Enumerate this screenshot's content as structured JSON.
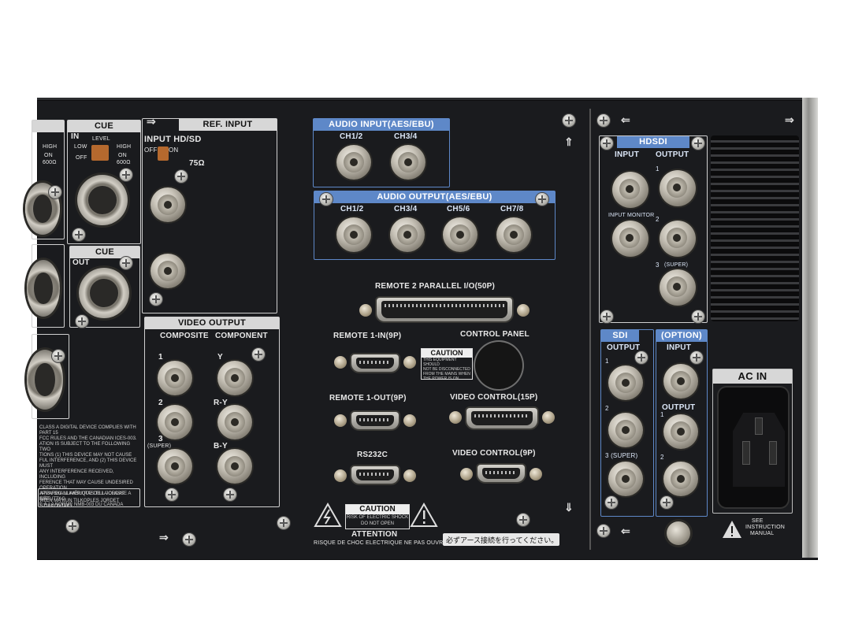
{
  "sections": {
    "cue_in": {
      "title": "CUE",
      "in": "IN",
      "level": "LEVEL",
      "low": "LOW",
      "high": "HIGH",
      "off": "OFF",
      "on": "ON",
      "ohm": "600Ω"
    },
    "cue_out": {
      "title": "CUE",
      "out": "OUT"
    },
    "left_partial": {
      "high": "HIGH",
      "on": "ON",
      "ohm": "600Ω"
    },
    "ref_input": {
      "title": "REF. INPUT",
      "input": "INPUT HD/SD",
      "off": "OFF",
      "on": "ON",
      "ohm": "75Ω"
    },
    "video_output": {
      "title": "VIDEO OUTPUT",
      "composite": "COMPOSITE",
      "component": "COMPONENT",
      "r1": "1",
      "r2": "2",
      "r3": "3",
      "super": "(SUPER)",
      "y": "Y",
      "ry": "R-Y",
      "by": "B-Y"
    },
    "audio_input": {
      "title": "AUDIO INPUT(AES/EBU)",
      "ch12": "CH1/2",
      "ch34": "CH3/4"
    },
    "audio_output": {
      "title": "AUDIO OUTPUT(AES/EBU)",
      "ch12": "CH1/2",
      "ch34": "CH3/4",
      "ch56": "CH5/6",
      "ch78": "CH7/8"
    },
    "hdsdi": {
      "title": "HDSDI",
      "input": "INPUT",
      "output": "OUTPUT",
      "input_monitor": "INPUT MONITOR",
      "n1": "1",
      "n2": "2",
      "n3": "3",
      "super": "(SUPER)"
    },
    "sdi": {
      "title": "SDI",
      "output": "OUTPUT",
      "n1": "1",
      "n2": "2",
      "n3": "3 (SUPER)"
    },
    "option": {
      "title": "(OPTION)",
      "input": "INPUT",
      "output": "OUTPUT",
      "n1": "1",
      "n2": "2"
    },
    "ac_in": {
      "title": "AC IN",
      "see": "SEE",
      "instruction": "INSTRUCTION",
      "manual": "MANUAL"
    }
  },
  "connectors": {
    "remote2": "REMOTE 2 PARALLEL I/O(50P)",
    "remote1_in": "REMOTE 1-IN(9P)",
    "control_panel": "CONTROL PANEL",
    "remote1_out": "REMOTE 1-OUT(9P)",
    "video_control_15p": "VIDEO CONTROL(15P)",
    "rs232c": "RS232C",
    "video_control_9p": "VIDEO CONTROL(9P)"
  },
  "caution_small": {
    "title": "CAUTION",
    "line1": "THIS EQUIPMENT SHOULD",
    "line2": "NOT BE DISCONNECTED",
    "line3": "FROM THE MAINS WHEN",
    "line4": "THE POWER IS ON"
  },
  "caution_main": {
    "title": "CAUTION",
    "line1": "RISK OF ELECTRIC SHOCK",
    "line2": "DO NOT OPEN",
    "attention": "ATTENTION",
    "french": "RISQUE DE CHOC ELECTRIQUE    NE PAS OUVRIR",
    "japanese": "必ずアース接続を行ってください。"
  },
  "fcc_text": {
    "l1": "CLASS A DIGITAL DEVICE COMPLIES WITH PART 15",
    "l2": "FCC RULES AND THE CANADIAN ICES-003.",
    "l3": "ATION IS SUBJECT TO THE FOLLOWING TWO",
    "l4": "TIONS   (1) THIS DEVICE MAY NOT CAUSE",
    "l5": "FUL INTERFERENCE, AND (2) THIS DEVICE MUST",
    "l6": "ANY INTERFERENCE RECEIVED, INCLUDING",
    "l7": "FERENCE THAT MAY CAUSE UNDESIRED OPERATION",
    "l8": "APPAREIL NUMÉRIQUE DE LA CLASSE A EST",
    "l9": "E À LA NORME NMB-003 DU CANADA",
    "l10": "ATEN SKALL ANSLUTAS TILL JORDAT NÄTUTTAG",
    "l11": "ATEN MÅ KUN TILKOPLES JORDET STIKKONTAKT"
  }
}
